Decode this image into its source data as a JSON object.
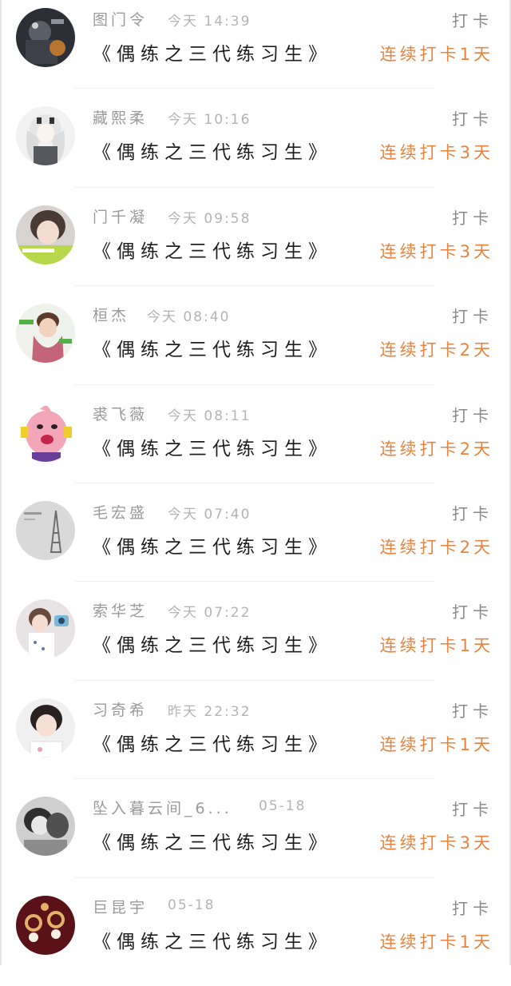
{
  "feed": {
    "items": [
      {
        "name": "图门令",
        "time": "今天 14:39",
        "title": "《偶练之三代练习生》",
        "action": "打卡",
        "streak": "连续打卡1天",
        "avatar": "avatar-dark-anime"
      },
      {
        "name": "藏熙柔",
        "time": "今天 10:16",
        "title": "《偶练之三代练习生》",
        "action": "打卡",
        "streak": "连续打卡3天",
        "avatar": "avatar-white-hair-anime"
      },
      {
        "name": "门千凝",
        "time": "今天 09:58",
        "title": "《偶练之三代练习生》",
        "action": "打卡",
        "streak": "连续打卡3天",
        "avatar": "avatar-girl-photo"
      },
      {
        "name": "桓杰",
        "time": "今天 08:40",
        "title": "《偶练之三代练习生》",
        "action": "打卡",
        "streak": "连续打卡2天",
        "avatar": "avatar-boy-scarf"
      },
      {
        "name": "裘飞薇",
        "time": "今天 08:11",
        "title": "《偶练之三代练习生》",
        "action": "打卡",
        "streak": "连续打卡2天",
        "avatar": "avatar-pink-cartoon"
      },
      {
        "name": "毛宏盛",
        "time": "今天 07:40",
        "title": "《偶练之三代练习生》",
        "action": "打卡",
        "streak": "连续打卡2天",
        "avatar": "avatar-eiffel-tower"
      },
      {
        "name": "索华芝",
        "time": "今天 07:22",
        "title": "《偶练之三代练习生》",
        "action": "打卡",
        "streak": "连续打卡1天",
        "avatar": "avatar-girl-camera"
      },
      {
        "name": "习奇希",
        "time": "昨天 22:32",
        "title": "《偶练之三代练习生》",
        "action": "打卡",
        "streak": "连续打卡1天",
        "avatar": "avatar-child-photo"
      },
      {
        "name": "坠入暮云间_6...",
        "time": "05-18",
        "title": "《偶练之三代练习生》",
        "action": "打卡",
        "streak": "连续打卡3天",
        "avatar": "avatar-bw-sketch"
      },
      {
        "name": "巨昆宇",
        "time": "05-18",
        "title": "《偶练之三代练习生》",
        "action": "打卡",
        "streak": "连续打卡1天",
        "avatar": "avatar-earrings"
      }
    ]
  },
  "colors": {
    "accent_orange": "#e8843f",
    "name_gray": "#9a9a9a",
    "time_gray": "#b4b4b4",
    "title_dark": "#1e1e1e",
    "divider": "#eeeeee"
  }
}
